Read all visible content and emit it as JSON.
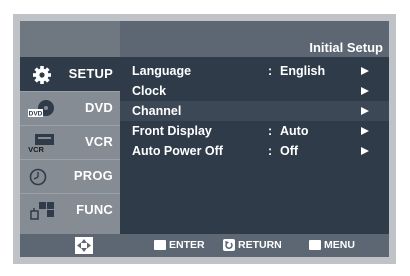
{
  "header": {
    "title": "Initial Setup"
  },
  "sidebar": {
    "items": [
      {
        "label": "SETUP",
        "icon": "gear-icon"
      },
      {
        "label": "DVD",
        "icon": "dvd-disc-icon"
      },
      {
        "label": "VCR",
        "icon": "vcr-tape-icon"
      },
      {
        "label": "PROG",
        "icon": "clock-icon"
      },
      {
        "label": "FUNC",
        "icon": "function-blocks-icon"
      }
    ]
  },
  "menu": {
    "items": [
      {
        "label": "Language",
        "colon": ":",
        "value": "English"
      },
      {
        "label": "Clock",
        "colon": "",
        "value": ""
      },
      {
        "label": "Channel",
        "colon": "",
        "value": ""
      },
      {
        "label": "Front Display",
        "colon": ":",
        "value": "Auto"
      },
      {
        "label": "Auto Power Off",
        "colon": ":",
        "value": "Off"
      }
    ]
  },
  "footer": {
    "enter_label": "ENTER",
    "return_label": "RETURN",
    "menu_label": "MENU"
  },
  "icon_text": {
    "dvd_badge": "DVD",
    "vcr_badge": "VCR"
  },
  "colors": {
    "panel_dark": "#2f3b49",
    "panel_mid": "#5d6774",
    "sidebar_inactive": "#868c94",
    "frame": "#bfc2c7"
  }
}
